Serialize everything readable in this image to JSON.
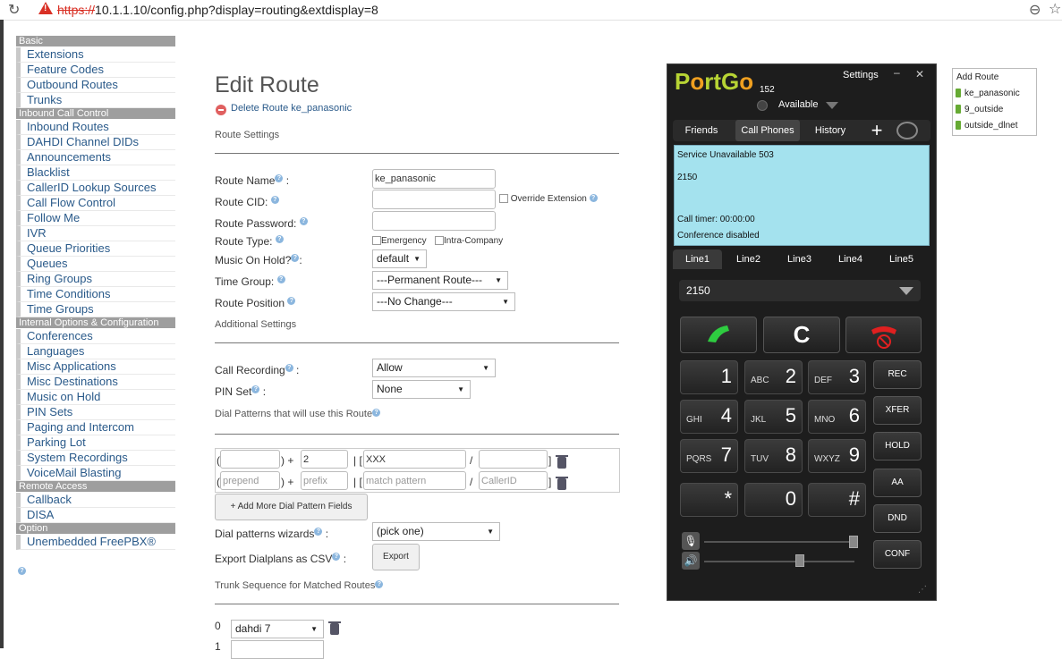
{
  "browser": {
    "url_scheme": "https://",
    "url_rest": "10.1.1.10/config.php?display=routing&extdisplay=8"
  },
  "sidebar": {
    "sections": [
      {
        "title": "Basic",
        "items": [
          "Extensions",
          "Feature Codes",
          "Outbound Routes",
          "Trunks"
        ]
      },
      {
        "title": "Inbound Call Control",
        "items": [
          "Inbound Routes",
          "DAHDI Channel DIDs",
          "Announcements",
          "Blacklist",
          "CallerID Lookup Sources",
          "Call Flow Control",
          "Follow Me",
          "IVR",
          "Queue Priorities",
          "Queues",
          "Ring Groups",
          "Time Conditions",
          "Time Groups"
        ]
      },
      {
        "title": "Internal Options & Configuration",
        "items": [
          "Conferences",
          "Languages",
          "Misc Applications",
          "Misc Destinations",
          "Music on Hold",
          "PIN Sets",
          "Paging and Intercom",
          "Parking Lot",
          "System Recordings",
          "VoiceMail Blasting"
        ]
      },
      {
        "title": "Remote Access",
        "items": [
          "Callback",
          "DISA"
        ]
      },
      {
        "title": "Option",
        "items": [
          "Unembedded FreePBX®"
        ]
      }
    ]
  },
  "main": {
    "title": "Edit Route",
    "delete_link": "Delete Route ke_panasonic",
    "route_settings": "Route Settings",
    "route_name_label": "Route Name",
    "route_name_value": "ke_panasonic",
    "route_cid_label": "Route CID:",
    "override_extension": "Override Extension",
    "route_password_label": "Route Password:",
    "route_type_label": "Route Type:",
    "emergency": "Emergency",
    "intra_company": "Intra-Company",
    "music_on_hold_label": "Music On Hold?",
    "music_on_hold_value": "default",
    "time_group_label": "Time Group:",
    "time_group_value": "---Permanent Route---",
    "route_position_label": "Route Position",
    "route_position_value": "---No Change---",
    "additional_settings": "Additional Settings",
    "call_recording_label": "Call Recording",
    "call_recording_value": "Allow",
    "pin_set_label": "PIN Set",
    "pin_set_value": "None",
    "dial_patterns_title": "Dial Patterns that will use this Route",
    "dial_rows": [
      {
        "prepend": "",
        "prefix": "2",
        "match": "XXX",
        "callerid": ""
      },
      {
        "prepend_ph": "prepend",
        "prefix_ph": "prefix",
        "match_ph": "match pattern",
        "callerid_ph": "CallerID"
      }
    ],
    "add_more_button": "+ Add More Dial Pattern Fields",
    "wizards_label": "Dial patterns wizards",
    "wizards_value": "(pick one)",
    "export_label": "Export Dialplans as CSV",
    "export_button": "Export",
    "trunk_sequence_title": "Trunk Sequence for Matched Routes",
    "trunk_rows": [
      {
        "index": "0",
        "value": "dahdi 7"
      },
      {
        "index": "1",
        "value": ""
      }
    ]
  },
  "portgo": {
    "logo_pre": "P",
    "logo_o": "o",
    "logo_mid": "rtG",
    "logo_end": "o",
    "settings": "Settings",
    "extension": "152",
    "status": "Available",
    "tabs": [
      "Friends",
      "Call Phones",
      "History"
    ],
    "display": {
      "line1": "Service Unavailable 503",
      "line2": "2150",
      "timer": "Call timer: 00:00:00",
      "conference": "Conference disabled"
    },
    "lines": [
      "Line1",
      "Line2",
      "Line3",
      "Line4",
      "Line5"
    ],
    "number": "2150",
    "clear_label": "C",
    "keys": [
      {
        "n": "1",
        "l": ""
      },
      {
        "n": "2",
        "l": "ABC"
      },
      {
        "n": "3",
        "l": "DEF"
      },
      {
        "n": "4",
        "l": "GHI"
      },
      {
        "n": "5",
        "l": "JKL"
      },
      {
        "n": "6",
        "l": "MNO"
      },
      {
        "n": "7",
        "l": "PQRS"
      },
      {
        "n": "8",
        "l": "TUV"
      },
      {
        "n": "9",
        "l": "WXYZ"
      },
      {
        "n": "*",
        "l": ""
      },
      {
        "n": "0",
        "l": ""
      },
      {
        "n": "#",
        "l": ""
      }
    ],
    "side_buttons": [
      "REC",
      "XFER",
      "HOLD",
      "AA",
      "DND",
      "CONF"
    ]
  },
  "routes_panel": {
    "title": "Add Route",
    "items": [
      "ke_panasonic",
      "9_outside",
      "outside_dlnet"
    ]
  },
  "colors": {
    "sidebar_header": "#9e9e9e",
    "link": "#2a5a8a",
    "portgo_bg": "#1d1d1d",
    "portgo_display": "#a4e2ee"
  }
}
